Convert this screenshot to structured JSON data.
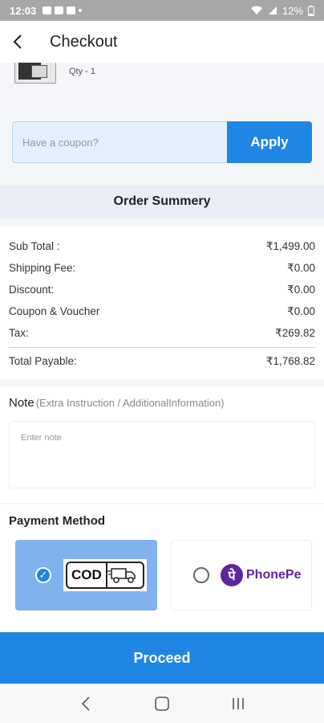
{
  "status_bar": {
    "time": "12:03",
    "battery": "12%"
  },
  "app_bar": {
    "title": "Checkout"
  },
  "product": {
    "qty": "Qty - 1"
  },
  "coupon": {
    "placeholder": "Have a coupon?",
    "apply_label": "Apply"
  },
  "summary": {
    "title": "Order Summery",
    "rows": [
      {
        "label": "Sub Total :",
        "value": "₹1,499.00"
      },
      {
        "label": "Shipping Fee:",
        "value": "₹0.00"
      },
      {
        "label": "Discount:",
        "value": "₹0.00"
      },
      {
        "label": "Coupon & Voucher",
        "value": "₹0.00"
      },
      {
        "label": "Tax:",
        "value": "₹269.82"
      }
    ],
    "total": {
      "label": "Total Payable:",
      "value": "₹1,768.82"
    }
  },
  "note": {
    "label": "Note",
    "sublabel": "(Extra Instruction / AdditionalInformation)",
    "placeholder": "Enter note"
  },
  "payment": {
    "title": "Payment Method",
    "options": [
      {
        "name": "COD",
        "selected": true
      },
      {
        "name": "PhonePe",
        "selected": false
      }
    ]
  },
  "proceed_label": "Proceed",
  "colors": {
    "primary": "#1f86e3",
    "selected_option": "#7fb2ee",
    "phonepe": "#5f259f"
  }
}
